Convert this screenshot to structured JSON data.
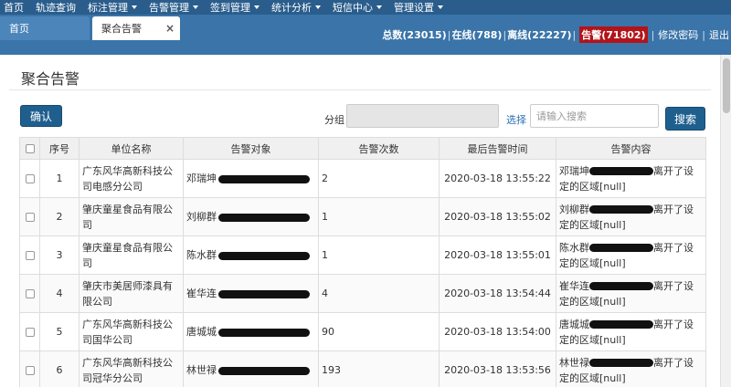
{
  "nav": {
    "items": [
      {
        "label": "首页",
        "dropdown": false
      },
      {
        "label": "轨迹查询",
        "dropdown": false
      },
      {
        "label": "标注管理",
        "dropdown": true
      },
      {
        "label": "告警管理",
        "dropdown": true
      },
      {
        "label": "签到管理",
        "dropdown": true
      },
      {
        "label": "统计分析",
        "dropdown": true
      },
      {
        "label": "短信中心",
        "dropdown": true
      },
      {
        "label": "管理设置",
        "dropdown": true
      }
    ]
  },
  "tabs": {
    "home": "首页",
    "aggregate": "聚合告警",
    "close_glyph": "×"
  },
  "stats": {
    "total": "总数(23015)",
    "online": "在线(788)",
    "offline": "离线(22227)",
    "alarm": "告警(71802)",
    "change_password": "修改密码",
    "logout": "退出",
    "sep": "|"
  },
  "page": {
    "title": "聚合告警"
  },
  "toolbar": {
    "confirm": "确认",
    "group_label": "分组",
    "group_value": "",
    "select_link": "选择",
    "search_placeholder": "请输入搜索",
    "search_button": "搜索"
  },
  "table": {
    "headers": [
      "序号",
      "单位名称",
      "告警对象",
      "告警次数",
      "最后告警时间",
      "告警内容"
    ],
    "rows": [
      {
        "seq": "1",
        "unit": "广东风华高新科技公司电感分公司",
        "target": "邓瑞坤",
        "count": "2",
        "time": "2020-03-18 13:55:22",
        "content_pre": "邓瑞坤",
        "content_post": "离开了设定的区域[null]"
      },
      {
        "seq": "2",
        "unit": "肇庆童星食品有限公司",
        "target": "刘柳群",
        "count": "1",
        "time": "2020-03-18 13:55:02",
        "content_pre": "刘柳群",
        "content_post": "离开了设定的区域[null]"
      },
      {
        "seq": "3",
        "unit": "肇庆童星食品有限公司",
        "target": "陈水群",
        "count": "1",
        "time": "2020-03-18 13:55:01",
        "content_pre": "陈水群",
        "content_post": "离开了设定的区域[null]"
      },
      {
        "seq": "4",
        "unit": "肇庆市美居师漆具有限公司",
        "target": "崔华连",
        "count": "4",
        "time": "2020-03-18 13:54:44",
        "content_pre": "崔华连",
        "content_post": "离开了设定的区域[null]"
      },
      {
        "seq": "5",
        "unit": "广东风华高新科技公司国华公司",
        "target": "唐城城",
        "count": "90",
        "time": "2020-03-18 13:54:00",
        "content_pre": "唐城城",
        "content_post": "离开了设定的区域[null]"
      },
      {
        "seq": "6",
        "unit": "广东风华高新科技公司冠华分公司",
        "target": "林世禄",
        "count": "193",
        "time": "2020-03-18 13:53:56",
        "content_pre": "林世禄",
        "content_post": "离开了设定的区域[null]"
      }
    ]
  },
  "colors": {
    "nav_bg": "#2a5d8c",
    "bar_bg": "#3a74a8",
    "alarm_bg": "#b3141a",
    "button_bg": "#1f5f8e",
    "link": "#2a6fb3"
  }
}
